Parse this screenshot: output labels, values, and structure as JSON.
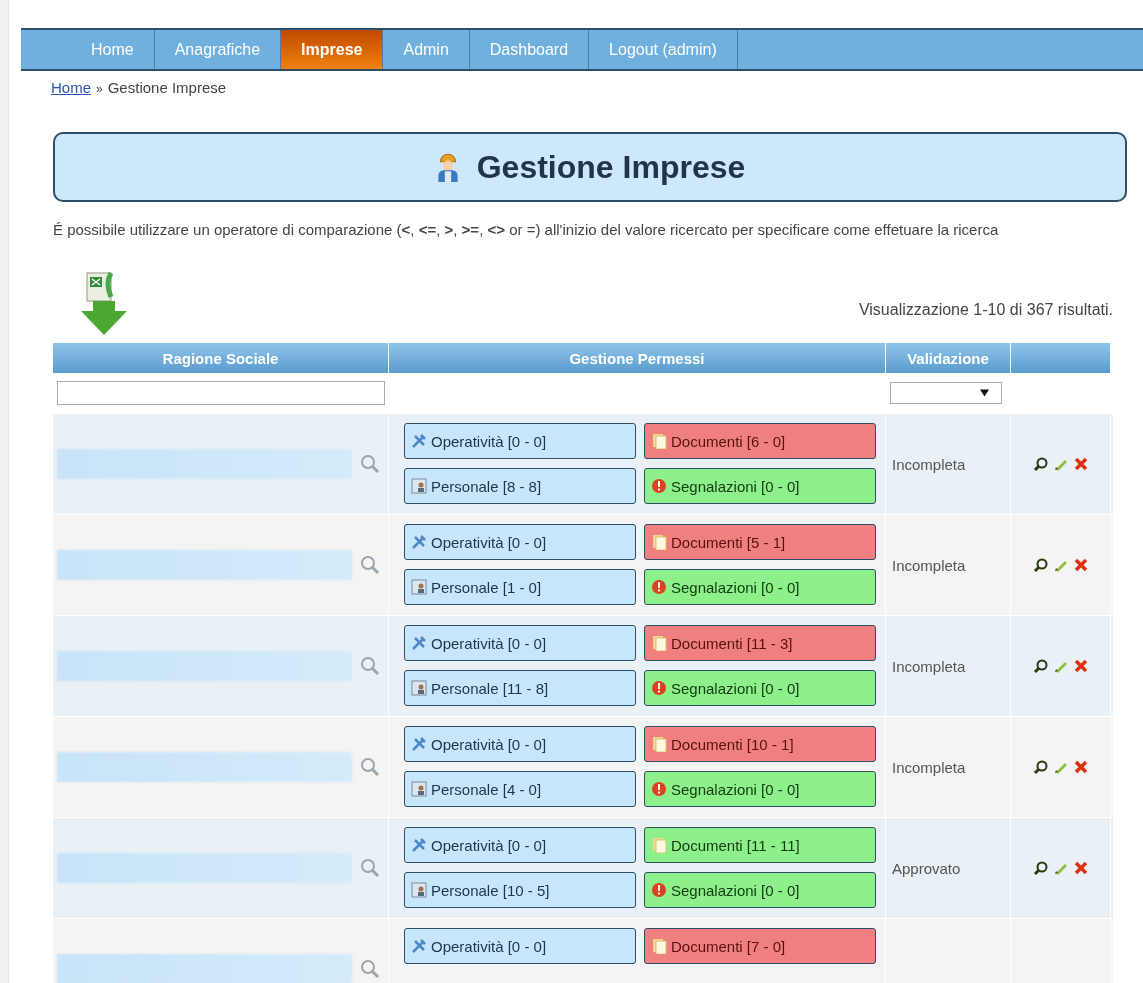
{
  "nav": [
    {
      "label": "Home",
      "selected": false
    },
    {
      "label": "Anagrafiche",
      "selected": false
    },
    {
      "label": "Imprese",
      "selected": true
    },
    {
      "label": "Admin",
      "selected": false
    },
    {
      "label": "Dashboard",
      "selected": false
    },
    {
      "label": "Logout (admin)",
      "selected": false
    }
  ],
  "breadcrumb": {
    "link": "Home",
    "separator": "»",
    "current": "Gestione Imprese"
  },
  "title": "Gestione Imprese",
  "hint": "É possibile utilizzare un operatore di comparazione (**<**, **<=**, **>**, **>=**, **<>** or =) all'inizio del valore ricercato per specificare come effetuare la ricerca",
  "summary": "Visualizzazione 1-10 di 367 risultati.",
  "table": {
    "columns": [
      "Ragione Sociale",
      "Gestione Permessi",
      "Validazione"
    ],
    "rows": [
      {
        "operativita": "Operatività [0 - 0]",
        "documenti": "Documenti [6 - 0]",
        "documenti_ok": false,
        "personale": "Personale [8 - 8]",
        "segnalazioni": "Segnalazioni [0 - 0]",
        "validazione": "Incompleta"
      },
      {
        "operativita": "Operatività [0 - 0]",
        "documenti": "Documenti [5 - 1]",
        "documenti_ok": false,
        "personale": "Personale [1 - 0]",
        "segnalazioni": "Segnalazioni [0 - 0]",
        "validazione": "Incompleta"
      },
      {
        "operativita": "Operatività [0 - 0]",
        "documenti": "Documenti [11 - 3]",
        "documenti_ok": false,
        "personale": "Personale [11 - 8]",
        "segnalazioni": "Segnalazioni [0 - 0]",
        "validazione": "Incompleta"
      },
      {
        "operativita": "Operatività [0 - 0]",
        "documenti": "Documenti [10 - 1]",
        "documenti_ok": false,
        "personale": "Personale [4 - 0]",
        "segnalazioni": "Segnalazioni [0 - 0]",
        "validazione": "Incompleta"
      },
      {
        "operativita": "Operatività [0 - 0]",
        "documenti": "Documenti [11 - 11]",
        "documenti_ok": true,
        "personale": "Personale [10 - 5]",
        "segnalazioni": "Segnalazioni [0 - 0]",
        "validazione": "Approvato"
      },
      {
        "operativita": "Operatività [0 - 0]",
        "documenti": "Documenti [7 - 0]",
        "documenti_ok": false
      }
    ]
  }
}
